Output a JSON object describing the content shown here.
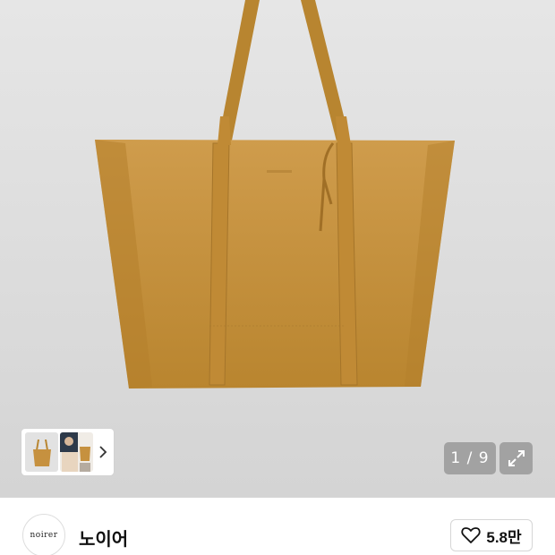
{
  "gallery": {
    "current": "1",
    "total": "9",
    "separator": " / ",
    "counter_text": "1 / 9"
  },
  "shop": {
    "logo_text": "noirer",
    "name": "노이어"
  },
  "like": {
    "count": "5.8만"
  },
  "colors": {
    "hero_background": "#dcdcdc",
    "bag": "#c6913f",
    "bag_shadow": "#a8772c",
    "overlay_button": "#7a7a7a"
  },
  "icons": {
    "chevron": "chevron-right-icon",
    "expand": "expand-icon",
    "heart": "heart-outline-icon"
  }
}
